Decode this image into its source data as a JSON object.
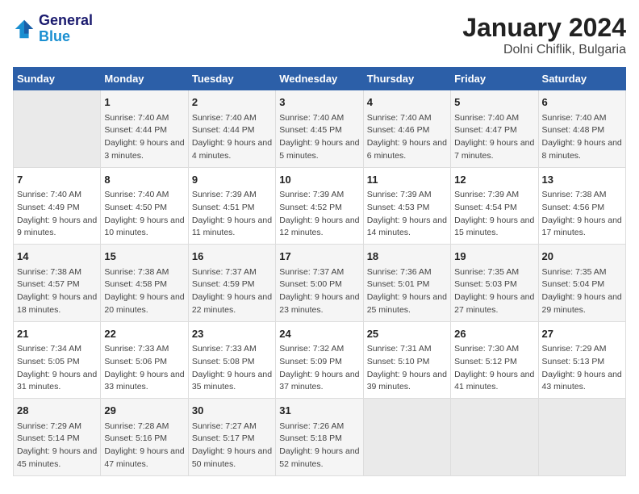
{
  "header": {
    "logo_line1": "General",
    "logo_line2": "Blue",
    "month": "January 2024",
    "location": "Dolni Chiflik, Bulgaria"
  },
  "days_of_week": [
    "Sunday",
    "Monday",
    "Tuesday",
    "Wednesday",
    "Thursday",
    "Friday",
    "Saturday"
  ],
  "weeks": [
    [
      {
        "day": "",
        "empty": true
      },
      {
        "day": "1",
        "sunrise": "Sunrise: 7:40 AM",
        "sunset": "Sunset: 4:44 PM",
        "daylight": "Daylight: 9 hours and 3 minutes."
      },
      {
        "day": "2",
        "sunrise": "Sunrise: 7:40 AM",
        "sunset": "Sunset: 4:44 PM",
        "daylight": "Daylight: 9 hours and 4 minutes."
      },
      {
        "day": "3",
        "sunrise": "Sunrise: 7:40 AM",
        "sunset": "Sunset: 4:45 PM",
        "daylight": "Daylight: 9 hours and 5 minutes."
      },
      {
        "day": "4",
        "sunrise": "Sunrise: 7:40 AM",
        "sunset": "Sunset: 4:46 PM",
        "daylight": "Daylight: 9 hours and 6 minutes."
      },
      {
        "day": "5",
        "sunrise": "Sunrise: 7:40 AM",
        "sunset": "Sunset: 4:47 PM",
        "daylight": "Daylight: 9 hours and 7 minutes."
      },
      {
        "day": "6",
        "sunrise": "Sunrise: 7:40 AM",
        "sunset": "Sunset: 4:48 PM",
        "daylight": "Daylight: 9 hours and 8 minutes."
      }
    ],
    [
      {
        "day": "7",
        "sunrise": "Sunrise: 7:40 AM",
        "sunset": "Sunset: 4:49 PM",
        "daylight": "Daylight: 9 hours and 9 minutes."
      },
      {
        "day": "8",
        "sunrise": "Sunrise: 7:40 AM",
        "sunset": "Sunset: 4:50 PM",
        "daylight": "Daylight: 9 hours and 10 minutes."
      },
      {
        "day": "9",
        "sunrise": "Sunrise: 7:39 AM",
        "sunset": "Sunset: 4:51 PM",
        "daylight": "Daylight: 9 hours and 11 minutes."
      },
      {
        "day": "10",
        "sunrise": "Sunrise: 7:39 AM",
        "sunset": "Sunset: 4:52 PM",
        "daylight": "Daylight: 9 hours and 12 minutes."
      },
      {
        "day": "11",
        "sunrise": "Sunrise: 7:39 AM",
        "sunset": "Sunset: 4:53 PM",
        "daylight": "Daylight: 9 hours and 14 minutes."
      },
      {
        "day": "12",
        "sunrise": "Sunrise: 7:39 AM",
        "sunset": "Sunset: 4:54 PM",
        "daylight": "Daylight: 9 hours and 15 minutes."
      },
      {
        "day": "13",
        "sunrise": "Sunrise: 7:38 AM",
        "sunset": "Sunset: 4:56 PM",
        "daylight": "Daylight: 9 hours and 17 minutes."
      }
    ],
    [
      {
        "day": "14",
        "sunrise": "Sunrise: 7:38 AM",
        "sunset": "Sunset: 4:57 PM",
        "daylight": "Daylight: 9 hours and 18 minutes."
      },
      {
        "day": "15",
        "sunrise": "Sunrise: 7:38 AM",
        "sunset": "Sunset: 4:58 PM",
        "daylight": "Daylight: 9 hours and 20 minutes."
      },
      {
        "day": "16",
        "sunrise": "Sunrise: 7:37 AM",
        "sunset": "Sunset: 4:59 PM",
        "daylight": "Daylight: 9 hours and 22 minutes."
      },
      {
        "day": "17",
        "sunrise": "Sunrise: 7:37 AM",
        "sunset": "Sunset: 5:00 PM",
        "daylight": "Daylight: 9 hours and 23 minutes."
      },
      {
        "day": "18",
        "sunrise": "Sunrise: 7:36 AM",
        "sunset": "Sunset: 5:01 PM",
        "daylight": "Daylight: 9 hours and 25 minutes."
      },
      {
        "day": "19",
        "sunrise": "Sunrise: 7:35 AM",
        "sunset": "Sunset: 5:03 PM",
        "daylight": "Daylight: 9 hours and 27 minutes."
      },
      {
        "day": "20",
        "sunrise": "Sunrise: 7:35 AM",
        "sunset": "Sunset: 5:04 PM",
        "daylight": "Daylight: 9 hours and 29 minutes."
      }
    ],
    [
      {
        "day": "21",
        "sunrise": "Sunrise: 7:34 AM",
        "sunset": "Sunset: 5:05 PM",
        "daylight": "Daylight: 9 hours and 31 minutes."
      },
      {
        "day": "22",
        "sunrise": "Sunrise: 7:33 AM",
        "sunset": "Sunset: 5:06 PM",
        "daylight": "Daylight: 9 hours and 33 minutes."
      },
      {
        "day": "23",
        "sunrise": "Sunrise: 7:33 AM",
        "sunset": "Sunset: 5:08 PM",
        "daylight": "Daylight: 9 hours and 35 minutes."
      },
      {
        "day": "24",
        "sunrise": "Sunrise: 7:32 AM",
        "sunset": "Sunset: 5:09 PM",
        "daylight": "Daylight: 9 hours and 37 minutes."
      },
      {
        "day": "25",
        "sunrise": "Sunrise: 7:31 AM",
        "sunset": "Sunset: 5:10 PM",
        "daylight": "Daylight: 9 hours and 39 minutes."
      },
      {
        "day": "26",
        "sunrise": "Sunrise: 7:30 AM",
        "sunset": "Sunset: 5:12 PM",
        "daylight": "Daylight: 9 hours and 41 minutes."
      },
      {
        "day": "27",
        "sunrise": "Sunrise: 7:29 AM",
        "sunset": "Sunset: 5:13 PM",
        "daylight": "Daylight: 9 hours and 43 minutes."
      }
    ],
    [
      {
        "day": "28",
        "sunrise": "Sunrise: 7:29 AM",
        "sunset": "Sunset: 5:14 PM",
        "daylight": "Daylight: 9 hours and 45 minutes."
      },
      {
        "day": "29",
        "sunrise": "Sunrise: 7:28 AM",
        "sunset": "Sunset: 5:16 PM",
        "daylight": "Daylight: 9 hours and 47 minutes."
      },
      {
        "day": "30",
        "sunrise": "Sunrise: 7:27 AM",
        "sunset": "Sunset: 5:17 PM",
        "daylight": "Daylight: 9 hours and 50 minutes."
      },
      {
        "day": "31",
        "sunrise": "Sunrise: 7:26 AM",
        "sunset": "Sunset: 5:18 PM",
        "daylight": "Daylight: 9 hours and 52 minutes."
      },
      {
        "day": "",
        "empty": true
      },
      {
        "day": "",
        "empty": true
      },
      {
        "day": "",
        "empty": true
      }
    ]
  ]
}
